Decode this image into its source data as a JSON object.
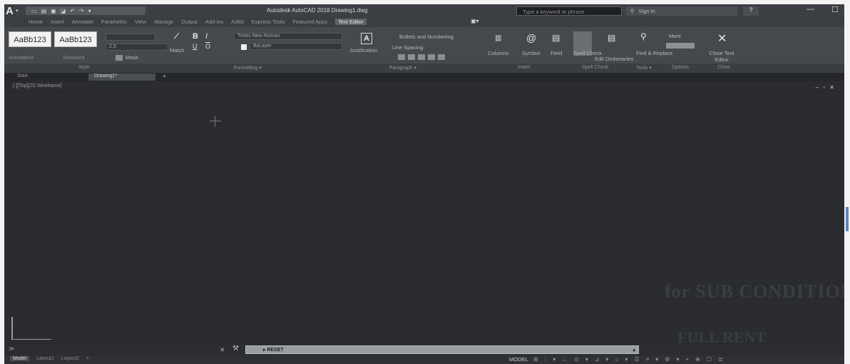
{
  "titlebar": {
    "logo": "A",
    "logo_arrow": "▾",
    "qat_icons": [
      "▭",
      "▤",
      "▣",
      "◪",
      "↶",
      "↷",
      "▾"
    ],
    "title": "Autodesk AutoCAD 2018   Drawing1.dwg",
    "search_placeholder": "Type a keyword or phrase",
    "signin_icon": "⚲",
    "signin_text": "Sign In",
    "help": "?",
    "window_buttons": [
      "—",
      "☐"
    ]
  },
  "ribbon_tabs": {
    "items": [
      "Home",
      "Insert",
      "Annotate",
      "Parametric",
      "View",
      "Manage",
      "Output",
      "Add-ins",
      "A360",
      "Express Tools",
      "Featured Apps",
      "Text Editor"
    ],
    "active_index": 11,
    "extra": "▣▾"
  },
  "ribbon": {
    "style_1": "AaBb123",
    "style_2": "AaBb123",
    "annotative_label": "Annotative",
    "standard_label": "Standard",
    "text_height": "2.5",
    "bold": "B",
    "italic": "I",
    "underline": "U",
    "overline": "O",
    "font_name": "Times New Roman",
    "color_name": "ByLayer",
    "match_label": "Match",
    "mask_label": "Mask",
    "justification_label": "Justification",
    "bullets_label": "Bullets and Numbering",
    "line_spacing_label": "Line Spacing",
    "columns_label": "Columns",
    "symbol_label": "Symbol",
    "field_label": "Field",
    "spell_check_label": "Spell Check",
    "edit_dictionaries_label": "Edit Dictionaries",
    "find_replace_label": "Find & Replace",
    "more_label": "More",
    "close_label": "Close Text Editor",
    "symbol_icon": "@",
    "close_icon": "✕"
  },
  "panel_titles": {
    "style": "Style",
    "formatting": "Formatting ▾",
    "paragraph": "Paragraph ▾",
    "insert": "Insert",
    "spelling": "Spell Check",
    "tools": "Tools ▾",
    "options": "Options",
    "close": "Close"
  },
  "file_tabs": {
    "start": "Start",
    "drawing": "Drawing1*",
    "add": "+"
  },
  "viewport": {
    "view_controls": "[-][Top][2D Wireframe]",
    "win_controls": "– ▫ ✕"
  },
  "command_line": {
    "history_toggle": "≫",
    "close_icon": "✕",
    "wrench_icon": "⚒",
    "input_text": "▸ RESET",
    "arrow": "▴"
  },
  "status_bar": {
    "layout_tabs": [
      "Model",
      "Layout1",
      "Layout2",
      "+"
    ],
    "active_index": 0,
    "model_label": "MODEL",
    "icons": [
      "⊞",
      "⁝",
      "▾",
      "∟",
      "⊙",
      "▾",
      "⊿",
      "▾",
      "⌂",
      "▾",
      "☰",
      "≡",
      "▾",
      "⚙",
      "▾",
      "+",
      "⊕",
      "☐",
      "≣"
    ]
  },
  "bleed_text": {
    "line1": "for SUB CONDITION",
    "line2": "FULL RENT"
  },
  "colors": {
    "app_bg": "#2b2d30",
    "ribbon_bg": "#45484c",
    "active_tab": "#5f6367",
    "command_input": "#9a9ea3"
  }
}
